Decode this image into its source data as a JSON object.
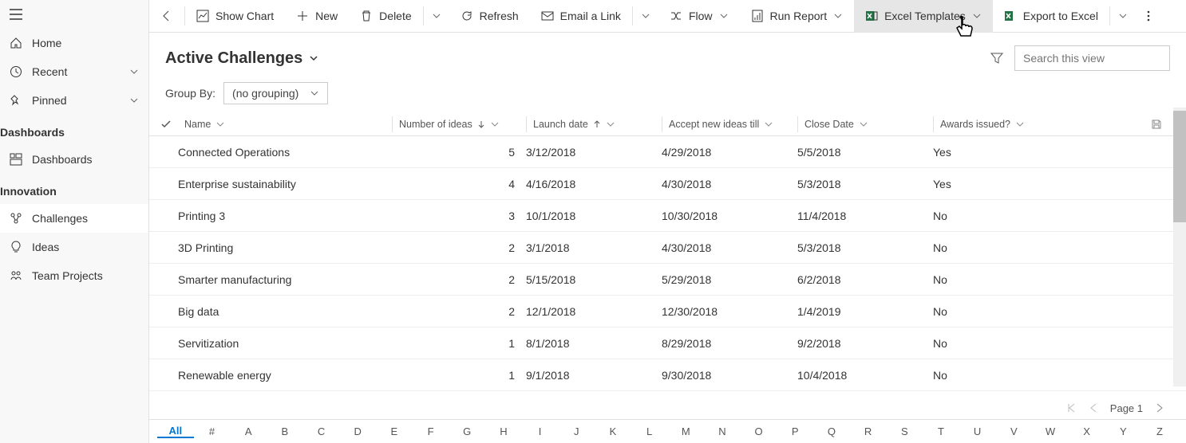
{
  "sidebar": {
    "home": "Home",
    "recent": "Recent",
    "pinned": "Pinned",
    "section1": "Dashboards",
    "dashboards": "Dashboards",
    "section2": "Innovation",
    "challenges": "Challenges",
    "ideas": "Ideas",
    "teamProjects": "Team Projects"
  },
  "toolbar": {
    "showChart": "Show Chart",
    "new": "New",
    "delete": "Delete",
    "refresh": "Refresh",
    "emailLink": "Email a Link",
    "flow": "Flow",
    "runReport": "Run Report",
    "excelTemplates": "Excel Templates",
    "exportExcel": "Export to Excel"
  },
  "view": {
    "title": "Active Challenges",
    "searchPlaceholder": "Search this view",
    "groupByLabel": "Group By:",
    "groupByValue": "(no grouping)"
  },
  "columns": {
    "name": "Name",
    "ideas": "Number of ideas",
    "launch": "Launch date",
    "accept": "Accept new ideas till",
    "close": "Close Date",
    "awards": "Awards issued?"
  },
  "rows": [
    {
      "name": "Connected Operations",
      "ideas": "5",
      "launch": "3/12/2018",
      "accept": "4/29/2018",
      "close": "5/5/2018",
      "awards": "Yes"
    },
    {
      "name": "Enterprise sustainability",
      "ideas": "4",
      "launch": "4/16/2018",
      "accept": "4/30/2018",
      "close": "5/3/2018",
      "awards": "Yes"
    },
    {
      "name": "Printing 3",
      "ideas": "3",
      "launch": "10/1/2018",
      "accept": "10/30/2018",
      "close": "11/4/2018",
      "awards": "No"
    },
    {
      "name": "3D Printing",
      "ideas": "2",
      "launch": "3/1/2018",
      "accept": "4/30/2018",
      "close": "5/3/2018",
      "awards": "No"
    },
    {
      "name": "Smarter manufacturing",
      "ideas": "2",
      "launch": "5/15/2018",
      "accept": "5/29/2018",
      "close": "6/2/2018",
      "awards": "No"
    },
    {
      "name": "Big data",
      "ideas": "2",
      "launch": "12/1/2018",
      "accept": "12/30/2018",
      "close": "1/4/2019",
      "awards": "No"
    },
    {
      "name": "Servitization",
      "ideas": "1",
      "launch": "8/1/2018",
      "accept": "8/29/2018",
      "close": "9/2/2018",
      "awards": "No"
    },
    {
      "name": "Renewable energy",
      "ideas": "1",
      "launch": "9/1/2018",
      "accept": "9/30/2018",
      "close": "10/4/2018",
      "awards": "No"
    }
  ],
  "pager": {
    "page": "Page 1"
  },
  "alpha": [
    "All",
    "#",
    "A",
    "B",
    "C",
    "D",
    "E",
    "F",
    "G",
    "H",
    "I",
    "J",
    "K",
    "L",
    "M",
    "N",
    "O",
    "P",
    "Q",
    "R",
    "S",
    "T",
    "U",
    "V",
    "W",
    "X",
    "Y",
    "Z"
  ]
}
